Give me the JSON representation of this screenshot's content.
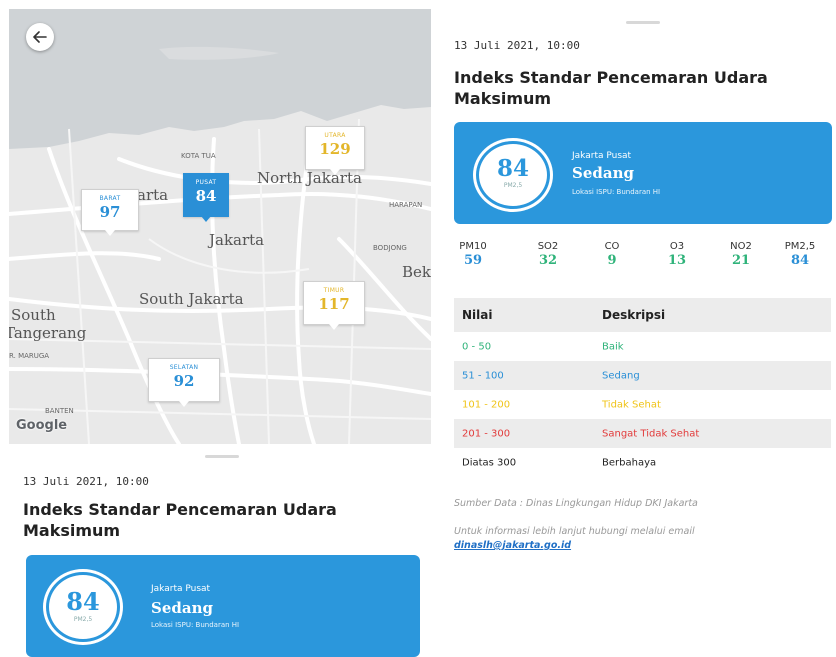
{
  "map": {
    "labels": {
      "kota_tua": "KOTA TUA",
      "north_jakarta": "North Jakarta",
      "jakarta_west_fragment": "arta",
      "jakarta": "Jakarta",
      "south_jakarta": "South Jakarta",
      "south": "South",
      "tangerang": "Tangerang",
      "harapan": "HARAPAN",
      "bodjong": "BODJONG",
      "bek": "Bek",
      "maruga": "R. MARUGA",
      "banten": "BANTEN"
    },
    "attribution": "Google",
    "markers": [
      {
        "name": "BARAT",
        "value": "97",
        "color": "#2a8fd6"
      },
      {
        "name": "PUSAT",
        "value": "84",
        "color": "#ffffff"
      },
      {
        "name": "UTARA",
        "value": "129",
        "color": "#e3b62a"
      },
      {
        "name": "TIMUR",
        "value": "117",
        "color": "#e3b62a"
      },
      {
        "name": "SELATAN",
        "value": "92",
        "color": "#2a8fd6"
      }
    ]
  },
  "sheet": {
    "date": "13 Juli 2021, 10:00",
    "title_line1": "Indeks Standar Pencemaran Udara",
    "title_line2": "Maksimum",
    "card": {
      "value": "84",
      "unit": "PM2,5",
      "region": "Jakarta Pusat",
      "status": "Sedang",
      "location": "Lokasi ISPU: Bundaran HI"
    }
  },
  "pollutants": [
    {
      "name": "PM10",
      "value": "59",
      "color": "#2a8fd6"
    },
    {
      "name": "SO2",
      "value": "32",
      "color": "#2fb37a"
    },
    {
      "name": "CO",
      "value": "9",
      "color": "#2fb37a"
    },
    {
      "name": "O3",
      "value": "13",
      "color": "#2fb37a"
    },
    {
      "name": "NO2",
      "value": "21",
      "color": "#2fb37a"
    },
    {
      "name": "PM2,5",
      "value": "84",
      "color": "#2a8fd6"
    }
  ],
  "table": {
    "header": {
      "col1": "Nilai",
      "col2": "Deskripsi"
    },
    "rows": [
      {
        "range": "0 - 50",
        "desc": "Baik",
        "color": "#2fb37a"
      },
      {
        "range": "51 - 100",
        "desc": "Sedang",
        "color": "#2a8fd6"
      },
      {
        "range": "101 - 200",
        "desc": "Tidak Sehat",
        "color": "#f0c419"
      },
      {
        "range": "201 - 300",
        "desc": "Sangat Tidak Sehat",
        "color": "#e23b3b"
      },
      {
        "range": "Diatas 300",
        "desc": "Berbahaya",
        "color": "#222222"
      }
    ]
  },
  "source_note": "Sumber Data : Dinas Lingkungan Hidup DKI Jakarta",
  "contact_note": "Untuk informasi lebih lanjut hubungi melalui email",
  "contact_email": "dinaslh@jakarta.go.id",
  "icons": {
    "back": "arrow-left-icon"
  }
}
